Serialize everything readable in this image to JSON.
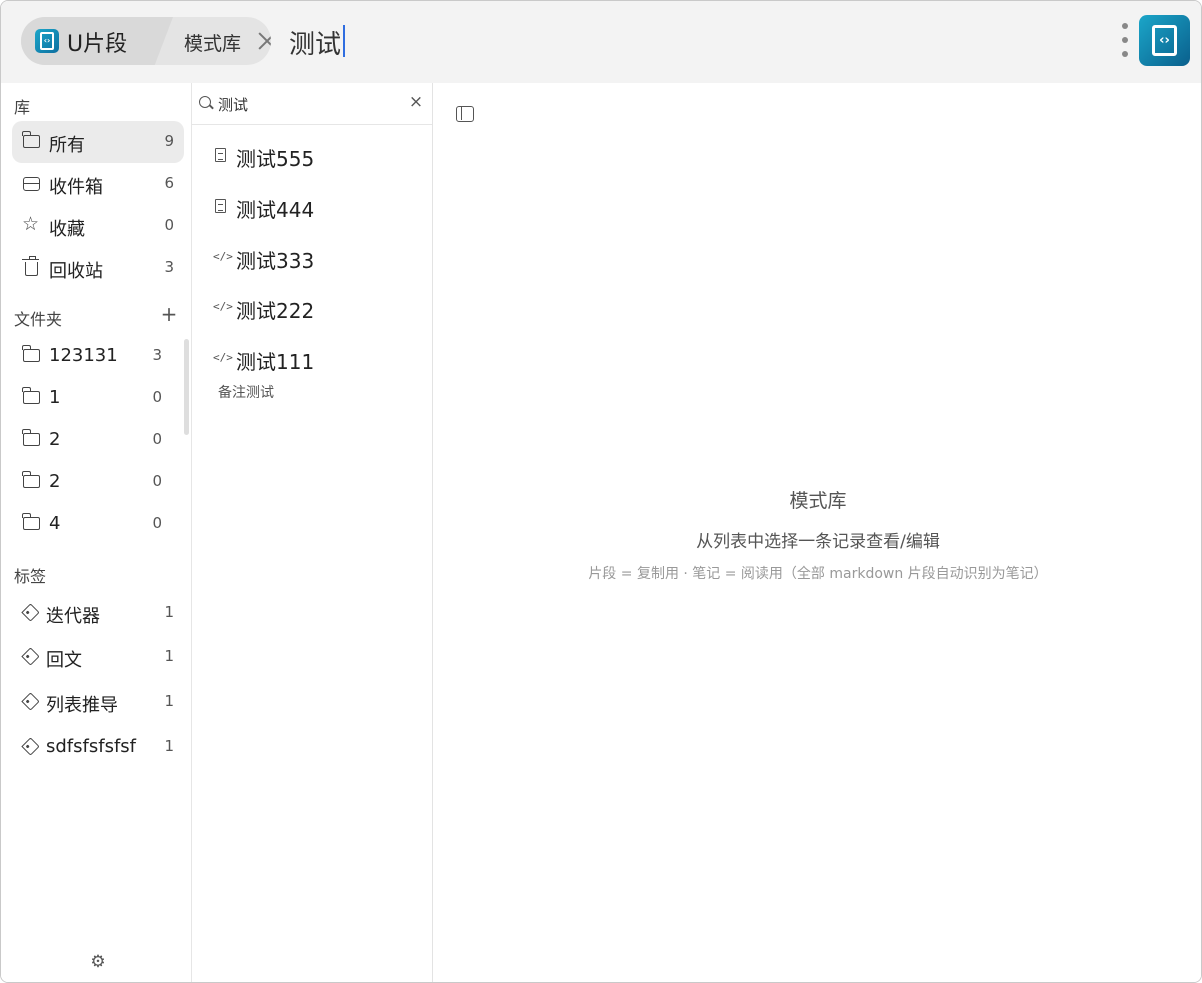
{
  "header": {
    "app_name": "U片段",
    "library_name": "模式库",
    "query": "测试"
  },
  "sidebar": {
    "library_title": "库",
    "library_items": [
      {
        "label": "所有",
        "count": "9",
        "icon": "folder-icon"
      },
      {
        "label": "收件箱",
        "count": "6",
        "icon": "inbox-icon"
      },
      {
        "label": "收藏",
        "count": "0",
        "icon": "star-icon"
      },
      {
        "label": "回收站",
        "count": "3",
        "icon": "trash-icon"
      }
    ],
    "folders_title": "文件夹",
    "add_folder_label": "+",
    "folders": [
      {
        "label": "123131",
        "count": "3"
      },
      {
        "label": "1",
        "count": "0"
      },
      {
        "label": "2",
        "count": "0"
      },
      {
        "label": "2",
        "count": "0"
      },
      {
        "label": "4",
        "count": "0"
      }
    ],
    "tags_title": "标签",
    "tags": [
      {
        "label": "迭代器",
        "count": "1"
      },
      {
        "label": "回文",
        "count": "1"
      },
      {
        "label": "列表推导",
        "count": "1"
      },
      {
        "label": "sdfsfsfsfsf",
        "count": "1"
      }
    ],
    "settings_icon": "gear-icon"
  },
  "list": {
    "search_value": "测试",
    "clear_label": "×",
    "items": [
      {
        "title": "测试555",
        "kind": "note",
        "note": ""
      },
      {
        "title": "测试444",
        "kind": "note",
        "note": ""
      },
      {
        "title": "测试333",
        "kind": "code",
        "note": ""
      },
      {
        "title": "测试222",
        "kind": "code",
        "note": ""
      },
      {
        "title": "测试111",
        "kind": "code",
        "note": "备注测试"
      }
    ]
  },
  "main": {
    "empty_title": "模式库",
    "empty_subtitle": "从列表中选择一条记录查看/编辑",
    "empty_hint": "片段 = 复制用 · 笔记 = 阅读用（全部 markdown 片段自动识别为笔记）"
  },
  "colors": {
    "accent": "#1ba6c9",
    "caret": "#2f6de0",
    "active_item_bg": "#ebebeb"
  }
}
